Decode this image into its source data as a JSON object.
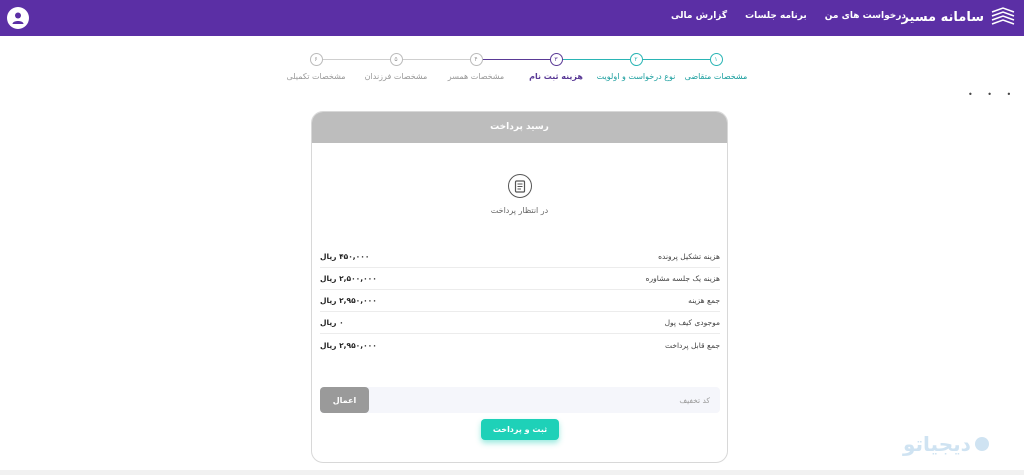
{
  "header": {
    "brand_title": "سامانه مسیر",
    "nav": [
      "درخواست های من",
      "برنامه جلسات",
      "گزارش مالی"
    ],
    "bg_color": "#5b2fa5"
  },
  "stepper": {
    "steps": [
      {
        "num": "۱",
        "label": "مشخصات متقاضی",
        "state": "done"
      },
      {
        "num": "۲",
        "label": "نوع درخواست و اولویت",
        "state": "done"
      },
      {
        "num": "۳",
        "label": "هزینه ثبت نام",
        "state": "current"
      },
      {
        "num": "۴",
        "label": "مشخصات همسر",
        "state": "pending"
      },
      {
        "num": "۵",
        "label": "مشخصات فرزندان",
        "state": "pending"
      },
      {
        "num": "۶",
        "label": "مشخصات تکمیلی",
        "state": "pending"
      }
    ]
  },
  "receipt": {
    "title": "رسید پرداخت",
    "status_icon": "receipt-icon",
    "status_text": "در انتظار پرداخت",
    "rows": [
      {
        "label": "هزینه تشکیل پرونده",
        "value": "۴۵۰,۰۰۰ ریال"
      },
      {
        "label": "هزینه یک جلسه مشاوره",
        "value": "۲,۵۰۰,۰۰۰ ریال"
      },
      {
        "label": "جمع هزینه",
        "value": "۲,۹۵۰,۰۰۰ ریال"
      },
      {
        "label": "موجودی کیف پول",
        "value": "۰ ریال"
      },
      {
        "label": "جمع قابل پرداخت",
        "value": "۲,۹۵۰,۰۰۰ ریال"
      }
    ],
    "discount_placeholder": "کد تخفیف",
    "discount_value": "",
    "apply_label": "اعمال",
    "submit_label": "ثبت و پرداخت"
  },
  "watermark": "دیجیاتو",
  "colors": {
    "accent_teal": "#1ed1b8",
    "step_done": "#2ab5b5",
    "step_current": "#5a3a96",
    "button_grey": "#9a9a9a"
  }
}
